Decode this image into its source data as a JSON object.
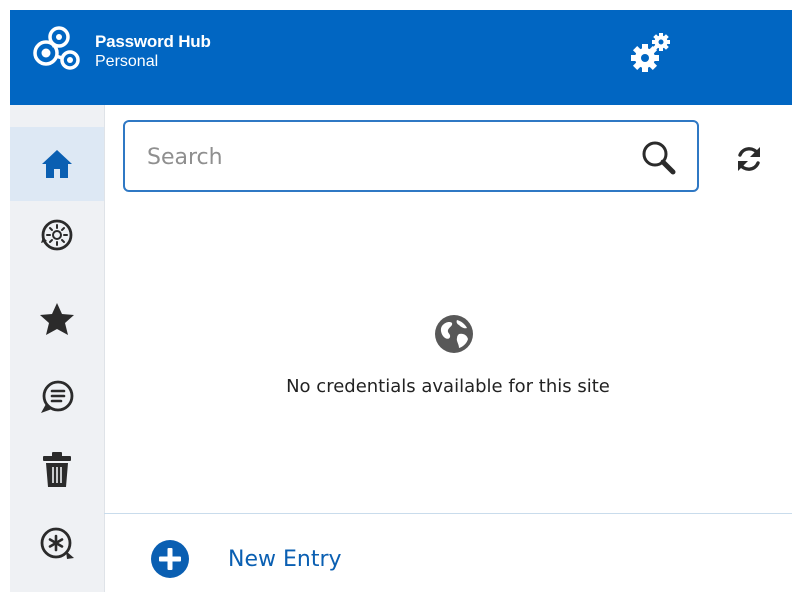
{
  "header": {
    "brand_title": "Password Hub",
    "brand_subtitle": "Personal",
    "settings_icon": "gears-icon"
  },
  "sidebar": {
    "items": [
      {
        "icon": "home-icon",
        "active": true
      },
      {
        "icon": "generator-icon",
        "active": false
      },
      {
        "icon": "star-icon",
        "active": false
      },
      {
        "icon": "chat-icon",
        "active": false
      },
      {
        "icon": "trash-icon",
        "active": false
      },
      {
        "icon": "password-icon",
        "active": false
      }
    ]
  },
  "search": {
    "placeholder": "Search",
    "value": ""
  },
  "empty_state": {
    "icon": "globe-icon",
    "message": "No credentials available for this site"
  },
  "footer": {
    "new_entry_label": "New Entry"
  },
  "colors": {
    "header_bg": "#0166c2",
    "accent": "#0a5fb2",
    "sidebar_bg": "#eff1f4",
    "sidebar_active": "#dde8f4",
    "icon_dark": "#2b2b2b"
  }
}
